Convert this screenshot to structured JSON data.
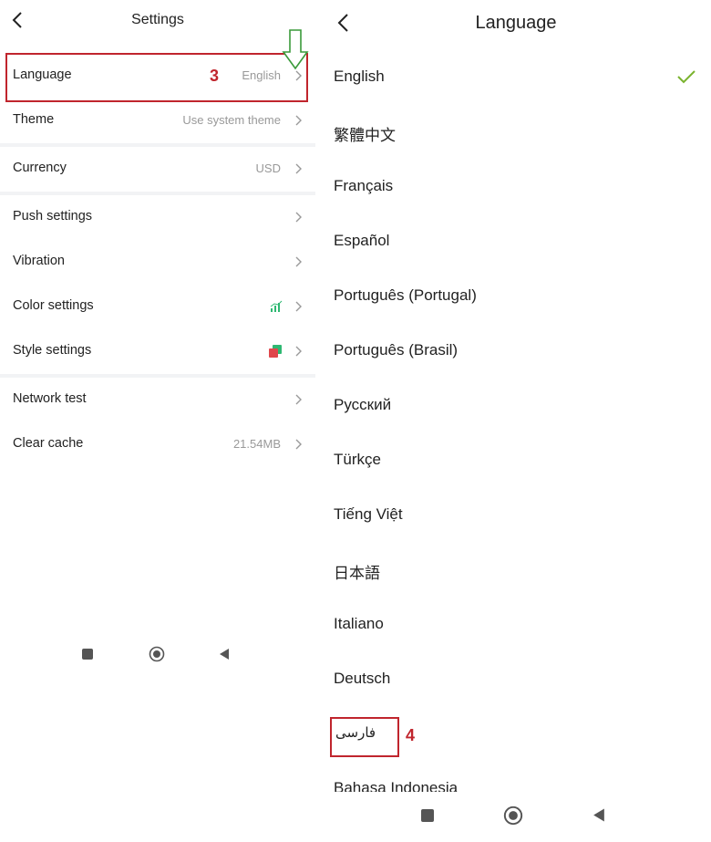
{
  "settings": {
    "title": "Settings",
    "rows": [
      {
        "label": "Language",
        "value": "English"
      },
      {
        "label": "Theme",
        "value": "Use system theme"
      },
      {
        "label": "Currency",
        "value": "USD"
      },
      {
        "label": "Push settings",
        "value": ""
      },
      {
        "label": "Vibration",
        "value": ""
      },
      {
        "label": "Color settings",
        "value": ""
      },
      {
        "label": "Style settings",
        "value": ""
      },
      {
        "label": "Network test",
        "value": ""
      },
      {
        "label": "Clear cache",
        "value": "21.54MB"
      }
    ],
    "annotation_step": "3"
  },
  "language": {
    "title": "Language",
    "selected": "English",
    "items": [
      "English",
      "繁體中文",
      "Français",
      "Español",
      "Português (Portugal)",
      "Português (Brasil)",
      "Русский",
      "Türkçe",
      "Tiếng Việt",
      "日本語",
      "Italiano",
      "Deutsch",
      "فارسی",
      "Bahasa Indonesia"
    ],
    "annotation_step": "4"
  },
  "colors": {
    "accent_check": "#7ab32e",
    "highlight_red": "#c0252d",
    "arrow_green": "#3a9a3a",
    "up_color": "#2eb872",
    "down_color": "#e0474c"
  },
  "icons": {
    "back": "chevron-left-icon",
    "row_chevron": "chevron-right-icon",
    "color_settings": "bar-chart-icon",
    "style_settings": "overlapping-squares-icon",
    "selected": "check-icon"
  }
}
